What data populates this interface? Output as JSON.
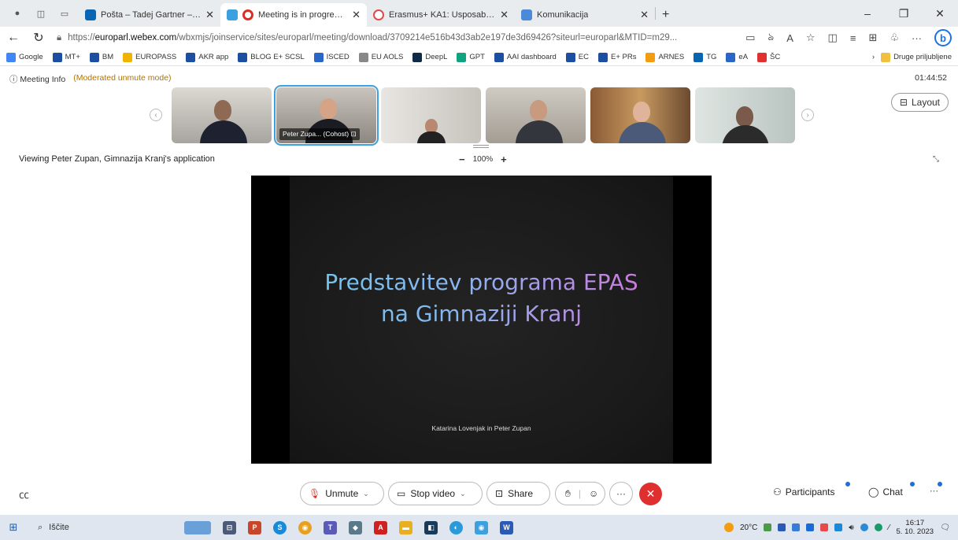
{
  "browser": {
    "tabs": [
      {
        "label": "Pošta – Tadej Gartner – Outlook",
        "color": "#0a64b4",
        "active": false
      },
      {
        "label": "Meeting is in progress...",
        "color": "#d93025",
        "active": true
      },
      {
        "label": "Erasmus+ KA1: Usposabljanje v t",
        "color": "#e04a4a",
        "active": false
      },
      {
        "label": "Komunikacija",
        "color": "#4a8ad8",
        "active": false
      }
    ],
    "new_tab": "+",
    "url_prefix": "https://",
    "url_host": "europarl.webex.com",
    "url_path": "/wbxmjs/joinservice/sites/europarl/meeting/download/3709214e516b43d3ab2e197de3d69426?siteurl=europarl&MTID=m29...",
    "profile": "b"
  },
  "bookmarks": {
    "items": [
      {
        "label": "Google",
        "color": "#4285f4"
      },
      {
        "label": "MT+",
        "color": "#1c4ea1"
      },
      {
        "label": "BM",
        "color": "#1c4ea1"
      },
      {
        "label": "EUROPASS",
        "color": "#f0b400"
      },
      {
        "label": "AKR app",
        "color": "#1c4ea1"
      },
      {
        "label": "BLOG E+ SCSL",
        "color": "#1c4ea1"
      },
      {
        "label": "ISCED",
        "color": "#2a66c8"
      },
      {
        "label": "EU AOLS",
        "color": "#888888"
      },
      {
        "label": "DeepL",
        "color": "#0f2b46"
      },
      {
        "label": "GPT",
        "color": "#10a37f"
      },
      {
        "label": "AAI dashboard",
        "color": "#1c4ea1"
      },
      {
        "label": "EC",
        "color": "#1c4ea1"
      },
      {
        "label": "E+ PRs",
        "color": "#1c4ea1"
      },
      {
        "label": "ARNES",
        "color": "#f39c12"
      },
      {
        "label": "TG",
        "color": "#0a64b4"
      },
      {
        "label": "eA",
        "color": "#2a66c8"
      },
      {
        "label": "ŠC",
        "color": "#e03030"
      }
    ],
    "more": "Druge priljubljene"
  },
  "webex": {
    "meeting_info": "Meeting Info",
    "mode": "(Moderated unmute mode)",
    "timer": "01:44:52",
    "layout_label": "Layout",
    "presenter_tag": "Peter Zupa... (Cohost)",
    "viewing": "Viewing Peter Zupan, Gimnazija Kranj's application",
    "zoom_minus": "−",
    "zoom_level": "100%",
    "zoom_plus": "+",
    "slide_title_line1": "Predstavitev programa EPAS",
    "slide_title_line2": "na Gimnaziji Kranj",
    "slide_subtitle": "Katarina Lovenjak in Peter Zupan",
    "controls": {
      "unmute": "Unmute",
      "stop_video": "Stop video",
      "share": "Share",
      "more": "···",
      "participants": "Participants",
      "chat": "Chat",
      "overflow": "···"
    }
  },
  "taskbar": {
    "search": "Iščite",
    "temperature": "20°C",
    "time": "16:17",
    "date": "5. 10. 2023"
  }
}
